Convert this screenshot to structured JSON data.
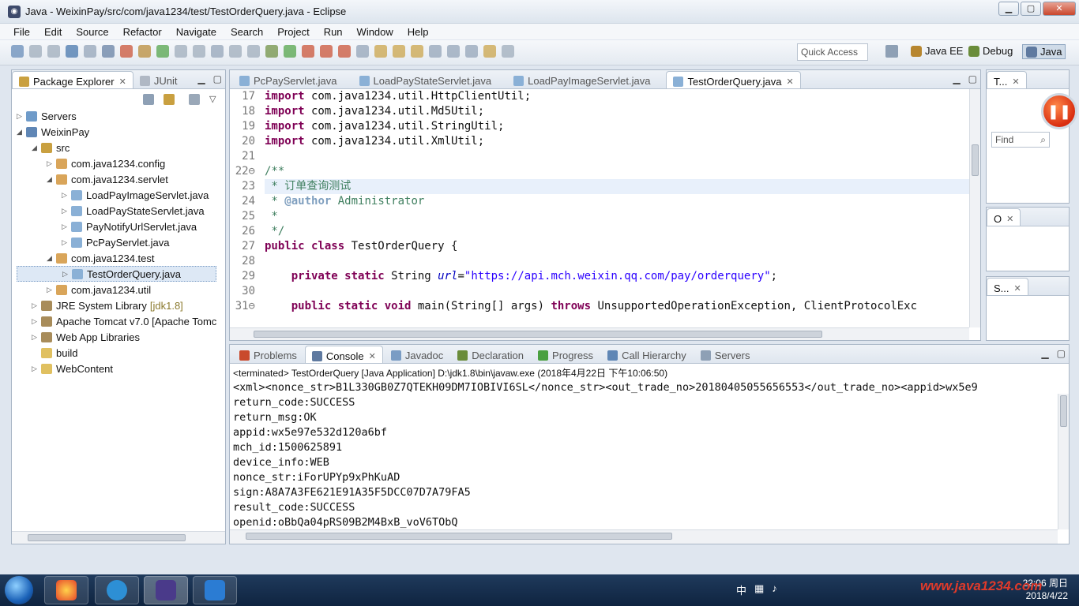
{
  "window": {
    "title": "Java - WeixinPay/src/com/java1234/test/TestOrderQuery.java - Eclipse"
  },
  "menu": [
    "File",
    "Edit",
    "Source",
    "Refactor",
    "Navigate",
    "Search",
    "Project",
    "Run",
    "Window",
    "Help"
  ],
  "quick_access": "Quick Access",
  "perspectives": {
    "javaee": "Java EE",
    "debug": "Debug",
    "java": "Java"
  },
  "left_panel": {
    "tabs": {
      "package_explorer": "Package Explorer",
      "junit": "JUnit"
    },
    "tree": [
      {
        "label": "Servers",
        "depth": 0,
        "arrow": "▷",
        "icon": "#6f9bc9"
      },
      {
        "label": "WeixinPay",
        "depth": 0,
        "arrow": "◢",
        "icon": "#5f86b5"
      },
      {
        "label": "src",
        "depth": 1,
        "arrow": "◢",
        "icon": "#c9a040"
      },
      {
        "label": "com.java1234.config",
        "depth": 2,
        "arrow": "▷",
        "icon": "#d9a55a"
      },
      {
        "label": "com.java1234.servlet",
        "depth": 2,
        "arrow": "◢",
        "icon": "#d9a55a"
      },
      {
        "label": "LoadPayImageServlet.java",
        "depth": 3,
        "arrow": "▷",
        "icon": "#8ab0d6"
      },
      {
        "label": "LoadPayStateServlet.java",
        "depth": 3,
        "arrow": "▷",
        "icon": "#8ab0d6"
      },
      {
        "label": "PayNotifyUrlServlet.java",
        "depth": 3,
        "arrow": "▷",
        "icon": "#8ab0d6"
      },
      {
        "label": "PcPayServlet.java",
        "depth": 3,
        "arrow": "▷",
        "icon": "#8ab0d6"
      },
      {
        "label": "com.java1234.test",
        "depth": 2,
        "arrow": "◢",
        "icon": "#d9a55a"
      },
      {
        "label": "TestOrderQuery.java",
        "depth": 3,
        "arrow": "▷",
        "icon": "#8ab0d6",
        "selected": true
      },
      {
        "label": "com.java1234.util",
        "depth": 2,
        "arrow": "▷",
        "icon": "#d9a55a"
      },
      {
        "label": "JRE System Library",
        "depth": 1,
        "arrow": "▷",
        "icon": "#a88c5a",
        "decor": "[jdk1.8]"
      },
      {
        "label": "Apache Tomcat v7.0 [Apache Tomc",
        "depth": 1,
        "arrow": "▷",
        "icon": "#a88c5a"
      },
      {
        "label": "Web App Libraries",
        "depth": 1,
        "arrow": "▷",
        "icon": "#a88c5a"
      },
      {
        "label": "build",
        "depth": 1,
        "arrow": "",
        "icon": "#e0c060"
      },
      {
        "label": "WebContent",
        "depth": 1,
        "arrow": "▷",
        "icon": "#e0c060"
      }
    ]
  },
  "editor": {
    "tabs": [
      "PcPayServlet.java",
      "LoadPayStateServlet.java",
      "LoadPayImageServlet.java",
      "TestOrderQuery.java"
    ],
    "lines": [
      {
        "n": "17",
        "html": "<span class='kw'>import</span> com.java1234.util.HttpClientUtil;"
      },
      {
        "n": "18",
        "html": "<span class='kw'>import</span> com.java1234.util.Md5Util;"
      },
      {
        "n": "19",
        "html": "<span class='kw'>import</span> com.java1234.util.StringUtil;"
      },
      {
        "n": "20",
        "html": "<span class='kw'>import</span> com.java1234.util.XmlUtil;"
      },
      {
        "n": "21",
        "html": ""
      },
      {
        "n": "22⊖",
        "html": "<span class='cm'>/**</span>"
      },
      {
        "n": "23",
        "html": "<span class='cm'> * 订单查询测试</span>",
        "hl": true
      },
      {
        "n": "24",
        "html": "<span class='cm'> * </span><span class='cmtag'>@author</span><span class='cm'> Administrator</span>"
      },
      {
        "n": "25",
        "html": "<span class='cm'> *</span>"
      },
      {
        "n": "26",
        "html": "<span class='cm'> */</span>"
      },
      {
        "n": "27",
        "html": "<span class='kw'>public class</span> TestOrderQuery {"
      },
      {
        "n": "28",
        "html": ""
      },
      {
        "n": "29",
        "html": "    <span class='kw'>private static</span> String <span class='fld'>url</span>=<span class='str'>\"https://api.mch.weixin.qq.com/pay/orderquery\"</span>;"
      },
      {
        "n": "30",
        "html": ""
      },
      {
        "n": "31⊖",
        "html": "    <span class='kw'>public static void</span> main(String[] args) <span class='kw'>throws</span> UnsupportedOperationException, ClientProtocolExc"
      }
    ]
  },
  "bottom_panel": {
    "tabs": [
      "Problems",
      "Console",
      "Javadoc",
      "Declaration",
      "Progress",
      "Call Hierarchy",
      "Servers"
    ],
    "terminated": "<terminated> TestOrderQuery [Java Application] D:\\jdk1.8\\bin\\javaw.exe (2018年4月22日 下午10:06:50)",
    "output": [
      "<xml><nonce_str>B1L330GB0Z7QTEKH09DM7IOBIVI6SL</nonce_str><out_trade_no>20180405055656553</out_trade_no><appid>wx5e9",
      "return_code:SUCCESS",
      "return_msg:OK",
      "appid:wx5e97e532d120a6bf",
      "mch_id:1500625891",
      "device_info:WEB",
      "nonce_str:iForUPYp9xPhKuAD",
      "sign:A8A7A3FE621E91A35F5DCC07D7A79FA5",
      "result_code:SUCCESS",
      "openid:oBbQa04pRS09B2M4BxB_voV6TObQ"
    ]
  },
  "right_panels": {
    "outline_tab": "T...",
    "find_label": "Find",
    "o_tab": "O",
    "s_tab": "S..."
  },
  "taskbar": {
    "time": "22:06 周日",
    "date": "2018/4/22",
    "tray_ime": "中"
  },
  "watermark": "www.java1234.com"
}
